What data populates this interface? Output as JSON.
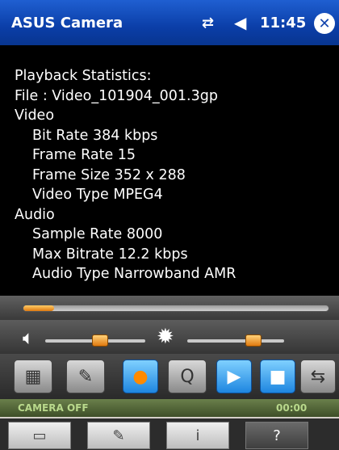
{
  "titlebar": {
    "app_title": "ASUS Camera",
    "connectivity_icon": "⇄",
    "volume_icon": "◀",
    "clock": "11:45",
    "close_label": "✕"
  },
  "info": {
    "heading": "Playback Statistics:",
    "file": "File :  Video_101904_001.3gp",
    "video_label": "Video",
    "bit_rate": "Bit Rate 384 kbps",
    "frame_rate": "Frame Rate 15",
    "frame_size": "Frame Size 352 x 288",
    "video_type": "Video Type MPEG4",
    "audio_label": "Audio",
    "sample_rate": "Sample Rate 8000",
    "max_bitrate": "Max Bitrate   12.2 kbps",
    "audio_type": "Audio Type Narrowband AMR"
  },
  "progress": {
    "fraction": 0.1
  },
  "volume": {
    "level": 0.55
  },
  "brightness": {
    "level": 0.68
  },
  "toolbar": {
    "gallery_icon": "▦",
    "settings_icon": "✎",
    "record_icon": "●",
    "zoom_icon": "Q",
    "play_icon": "▶",
    "stop_icon": "■",
    "switch_icon": "⇆"
  },
  "status": {
    "text": "CAMERA OFF",
    "time": "00:00"
  },
  "menu": {
    "tab1_icon": "▭",
    "tab2_icon": "✎",
    "tab3_icon": "i",
    "tab4_label": "?"
  },
  "colors": {
    "title_bar": "#0b3ea8",
    "accent_orange": "#e07a10",
    "play_blue": "#1e86e0",
    "status_green": "#b9d98c"
  }
}
